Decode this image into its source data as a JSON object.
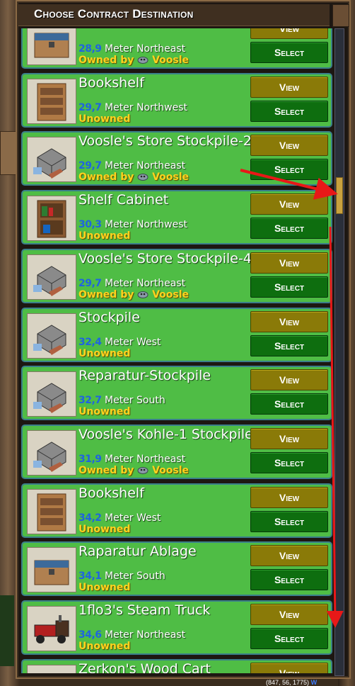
{
  "dialog": {
    "title": "Choose Contract Destination"
  },
  "buttons": {
    "view_label": "View",
    "select_label": "Select"
  },
  "colors": {
    "row_bg": "#4fbd45",
    "distance_num": "#1f64e0",
    "owner_text": "#ffd21e",
    "view_btn": "#8a7a08",
    "select_btn": "#0e6e0f",
    "annotation": "#e81818"
  },
  "rows": [
    {
      "name": "",
      "distance_num": "28,9",
      "distance_text": " Meter Northeast",
      "status": "Owned by",
      "owner": "Voosle",
      "icon": "storage-chest-icon"
    },
    {
      "name": "Bookshelf",
      "distance_num": "29,7",
      "distance_text": " Meter Northwest",
      "status": "Unowned",
      "owner": "",
      "icon": "bookshelf-icon"
    },
    {
      "name": "Voosle's Store Stockpile-2",
      "distance_num": "29,7",
      "distance_text": " Meter Northeast",
      "status": "Owned by",
      "owner": "Voosle",
      "icon": "stockpile-icon"
    },
    {
      "name": "Shelf Cabinet",
      "distance_num": "30,3",
      "distance_text": " Meter Northwest",
      "status": "Unowned",
      "owner": "",
      "icon": "shelf-cabinet-icon"
    },
    {
      "name": "Voosle's Store Stockpile-4",
      "distance_num": "29,7",
      "distance_text": " Meter Northeast",
      "status": "Owned by",
      "owner": "Voosle",
      "icon": "stockpile-icon"
    },
    {
      "name": "Stockpile",
      "distance_num": "32,4",
      "distance_text": " Meter West",
      "status": "Unowned",
      "owner": "",
      "icon": "stockpile-icon"
    },
    {
      "name": "Reparatur-Stockpile",
      "distance_num": "32,7",
      "distance_text": " Meter South",
      "status": "Unowned",
      "owner": "",
      "icon": "stockpile-icon"
    },
    {
      "name": "Voosle's Kohle-1 Stockpile",
      "distance_num": "31,9",
      "distance_text": " Meter Northeast",
      "status": "Owned by",
      "owner": "Voosle",
      "icon": "stockpile-icon"
    },
    {
      "name": "Bookshelf",
      "distance_num": "34,2",
      "distance_text": " Meter West",
      "status": "Unowned",
      "owner": "",
      "icon": "bookshelf-icon"
    },
    {
      "name": "Raparatur Ablage",
      "distance_num": "34,1",
      "distance_text": " Meter South",
      "status": "Unowned",
      "owner": "",
      "icon": "storage-chest-icon"
    },
    {
      "name": "1flo3's Steam Truck",
      "distance_num": "34,6",
      "distance_text": " Meter Northeast",
      "status": "Unowned",
      "owner": "",
      "icon": "steam-truck-icon"
    },
    {
      "name": "Zerkon's Wood Cart",
      "distance_num": "",
      "distance_text": "",
      "status": "",
      "owner": "",
      "icon": "wood-cart-icon"
    }
  ],
  "hud": {
    "coords": "(847, 56, 1775)",
    "compass": "W"
  }
}
